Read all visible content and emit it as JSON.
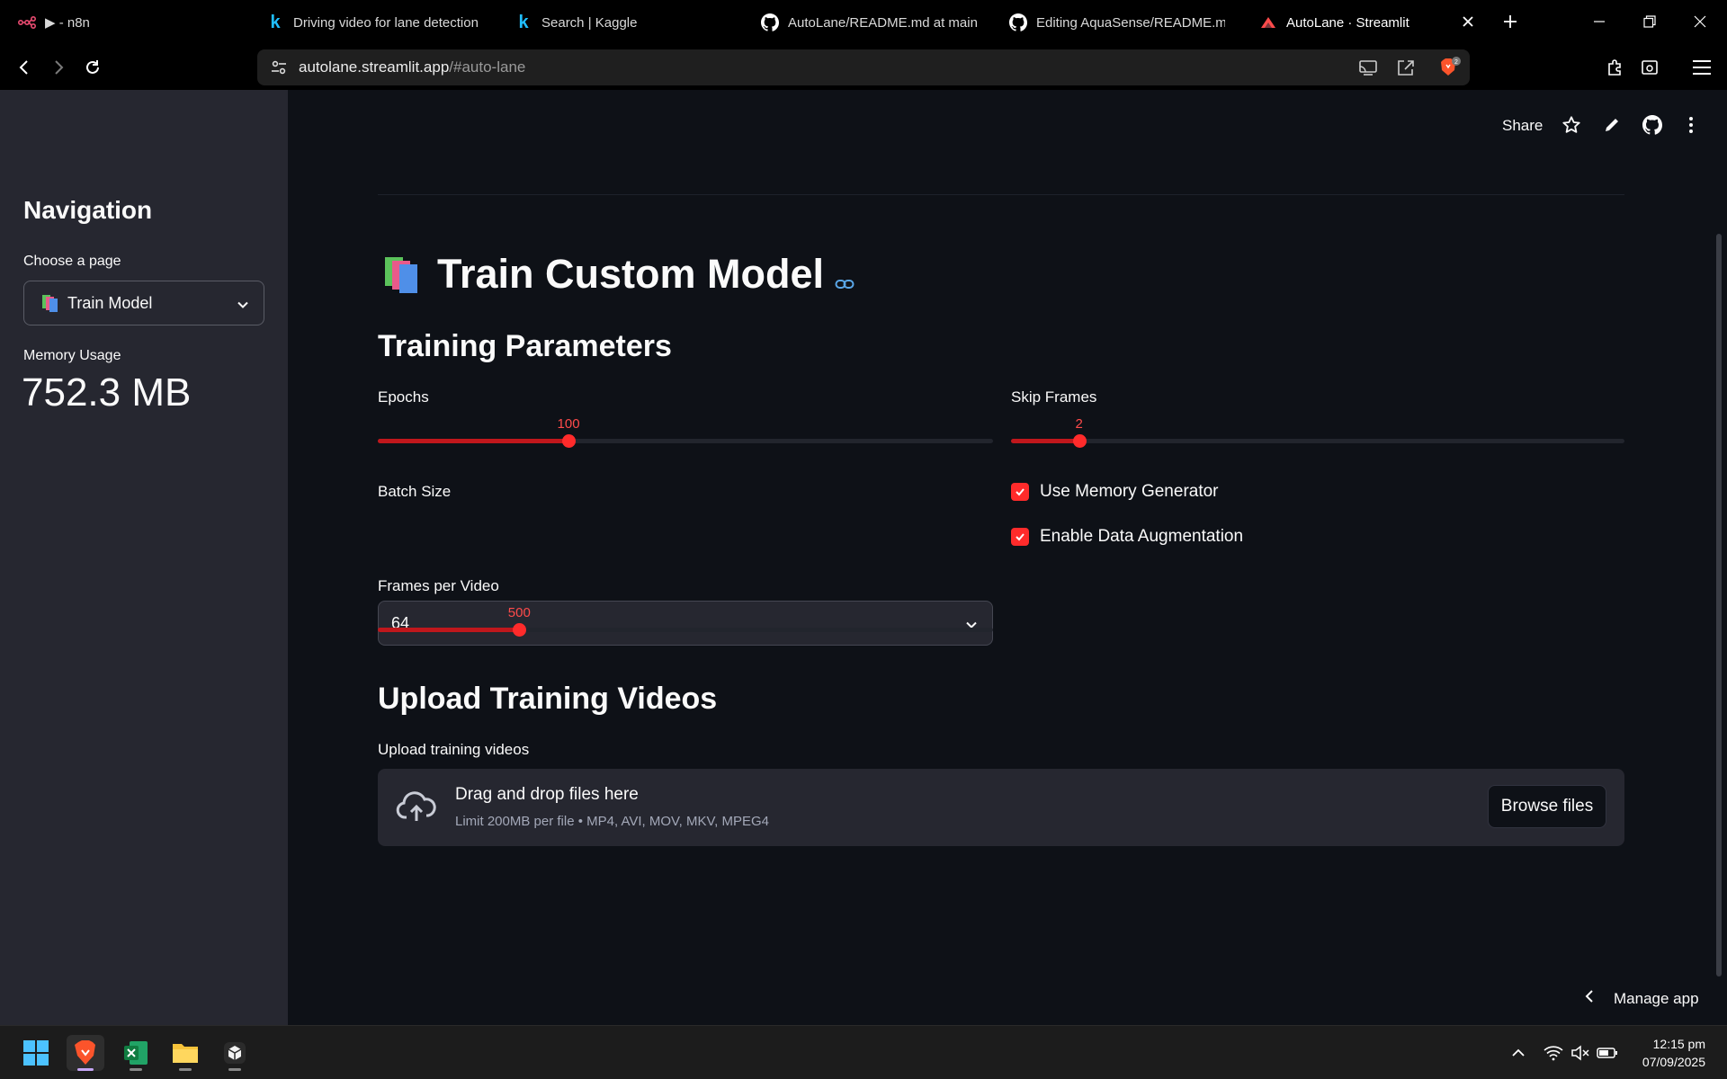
{
  "browser": {
    "tabs": [
      {
        "label": "▶ - n8n",
        "icon": "n8n-icon"
      },
      {
        "label": "Driving video for lane detection",
        "icon": "kaggle-icon"
      },
      {
        "label": "Search | Kaggle",
        "icon": "kaggle-icon"
      },
      {
        "label": "AutoLane/README.md at main ·",
        "icon": "github-icon"
      },
      {
        "label": "Editing AquaSense/README.md",
        "icon": "github-icon"
      },
      {
        "label": "AutoLane · Streamlit",
        "icon": "streamlit-icon",
        "active": true
      }
    ],
    "url_host": "autolane.streamlit.app",
    "url_path": "/#auto-lane",
    "brave_shield_count": "2"
  },
  "sidebar": {
    "title": "Navigation",
    "page_select_label": "Choose a page",
    "page_select_value": "Train Model",
    "memory_label": "Memory Usage",
    "memory_value": "752.3 MB"
  },
  "header": {
    "share_label": "Share"
  },
  "main": {
    "title": "Train Custom Model",
    "params_heading": "Training Parameters",
    "epochs": {
      "label": "Epochs",
      "value": "100",
      "fraction": 0.31
    },
    "skip_frames": {
      "label": "Skip Frames",
      "value": "2",
      "fraction": 0.111
    },
    "batch_size": {
      "label": "Batch Size",
      "value": "64"
    },
    "use_memory_generator": {
      "label": "Use Memory Generator",
      "checked": true
    },
    "data_augmentation": {
      "label": "Enable Data Augmentation",
      "checked": true
    },
    "frames_per_video": {
      "label": "Frames per Video",
      "value": "500",
      "fraction": 0.23
    },
    "upload_heading": "Upload Training Videos",
    "upload_label": "Upload training videos",
    "dropzone_title": "Drag and drop files here",
    "dropzone_limit": "Limit 200MB per file • MP4, AVI, MOV, MKV, MPEG4",
    "browse_label": "Browse files",
    "manage_label": "Manage app"
  },
  "taskbar": {
    "time": "12:15 pm",
    "date": "07/09/2025"
  },
  "colors": {
    "accent": "#ff4b4b",
    "app_bg": "#0e1117",
    "sidebar_bg": "#262730"
  }
}
